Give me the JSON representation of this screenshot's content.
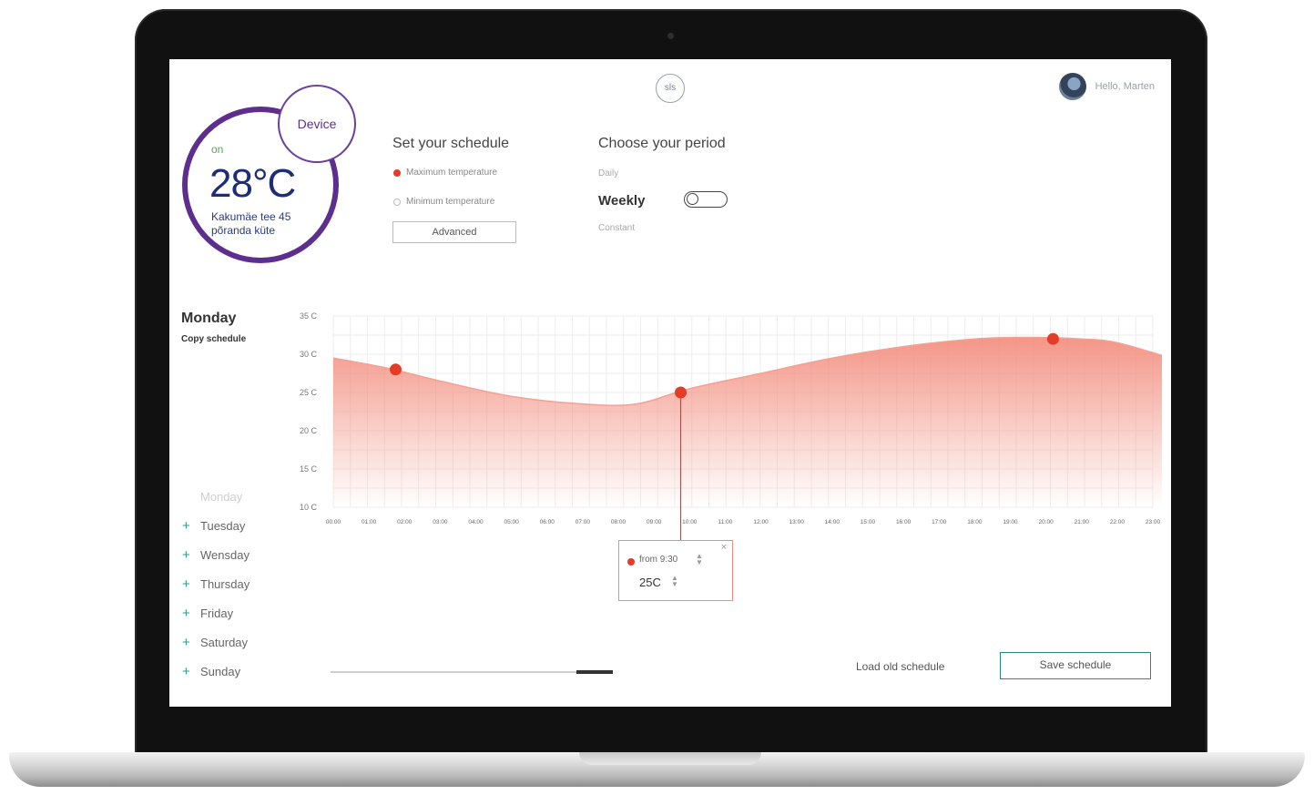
{
  "header": {
    "logo_text": "sls",
    "greeting": "Hello, Marten"
  },
  "device": {
    "badge": "Device",
    "status": "on",
    "temperature": "28°C",
    "location": "Kakumäe tee 45 põranda küte",
    "ring_color": "#5d2e8e"
  },
  "schedule": {
    "title": "Set your schedule",
    "legend": [
      {
        "label": "Maximum temperature",
        "color": "#e43c26"
      },
      {
        "label": "Minimum temperature",
        "color": "#cccccc"
      }
    ],
    "advanced_label": "Advanced"
  },
  "period": {
    "title": "Choose your period",
    "options": [
      "Daily",
      "Weekly",
      "Constant"
    ],
    "selected": "Weekly",
    "toggle_on": false
  },
  "day_panel": {
    "heading": "Monday",
    "copy_label": "Copy schedule",
    "current_day": "Monday",
    "days": [
      "Tuesday",
      "Wensday",
      "Thursday",
      "Friday",
      "Saturday",
      "Sunday"
    ],
    "add_icon": "plus-icon"
  },
  "chart_data": {
    "type": "area",
    "y_ticks": [
      "35 C",
      "30 C",
      "25 C",
      "20 C",
      "15 C",
      "10 C"
    ],
    "ylim": [
      10,
      35
    ],
    "x_labels": [
      "00:00",
      "01:00",
      "02:00",
      "03:00",
      "04:00",
      "05:00",
      "06:00",
      "07:00",
      "08:00",
      "09:00",
      "10:00",
      "11:00",
      "12:00",
      "13:00",
      "14:00",
      "15:00",
      "16:00",
      "17:00",
      "18:00",
      "19:00",
      "20:00",
      "21:00",
      "22:00",
      "23:00"
    ],
    "series": [
      {
        "x": [
          0,
          1.5,
          3,
          5,
          7,
          8.5,
          10,
          12,
          14,
          16,
          18,
          19.5,
          21,
          22,
          23.5
        ],
        "values": [
          29.5,
          28.2,
          26.5,
          24.5,
          23.5,
          23.5,
          25.5,
          27.5,
          29.5,
          31,
          32,
          32.2,
          32,
          31.5,
          29.5
        ]
      }
    ],
    "points": [
      {
        "x": 1.75,
        "y": 28
      },
      {
        "x": 9.75,
        "y": 25
      },
      {
        "x": 20.2,
        "y": 32
      }
    ],
    "selected_point": 1,
    "fill_color": "#f28a7a",
    "point_color": "#e43c26"
  },
  "tooltip": {
    "from_label": "from 9:30",
    "temp": "25C",
    "close": "×"
  },
  "footer": {
    "load_label": "Load old schedule",
    "save_label": "Save schedule"
  }
}
